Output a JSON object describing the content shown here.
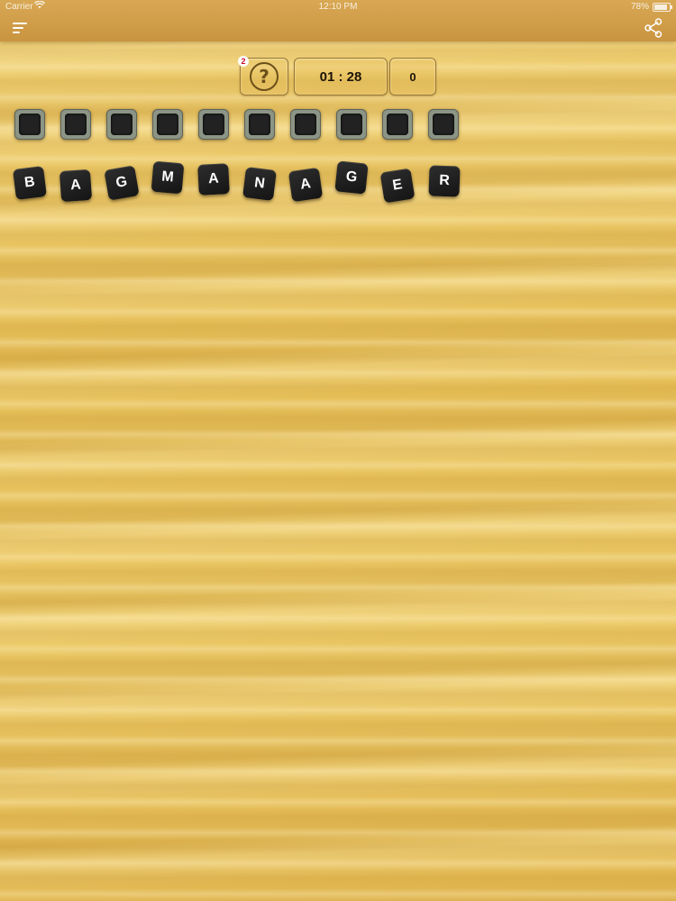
{
  "status_bar": {
    "carrier": "Carrier",
    "wifi_icon": "wifi-icon",
    "time": "12:10 PM",
    "battery": "78%",
    "battery_level": 0.78
  },
  "nav": {
    "menu_icon": "hamburger-menu-icon",
    "share_icon": "share-icon"
  },
  "hud": {
    "hints_remaining": "2",
    "hint_icon": "question-mark-icon",
    "timer": "01 : 28",
    "score": "0"
  },
  "answer_slots": [
    "",
    "",
    "",
    "",
    "",
    "",
    "",
    "",
    "",
    ""
  ],
  "letter_tiles": [
    "B",
    "A",
    "G",
    "M",
    "A",
    "N",
    "A",
    "G",
    "E",
    "R"
  ],
  "colors": {
    "wood": "#e8c25e",
    "tile": "#1a1a1a",
    "slot_frame": "#8c9486",
    "badge_text": "#c8102e"
  }
}
